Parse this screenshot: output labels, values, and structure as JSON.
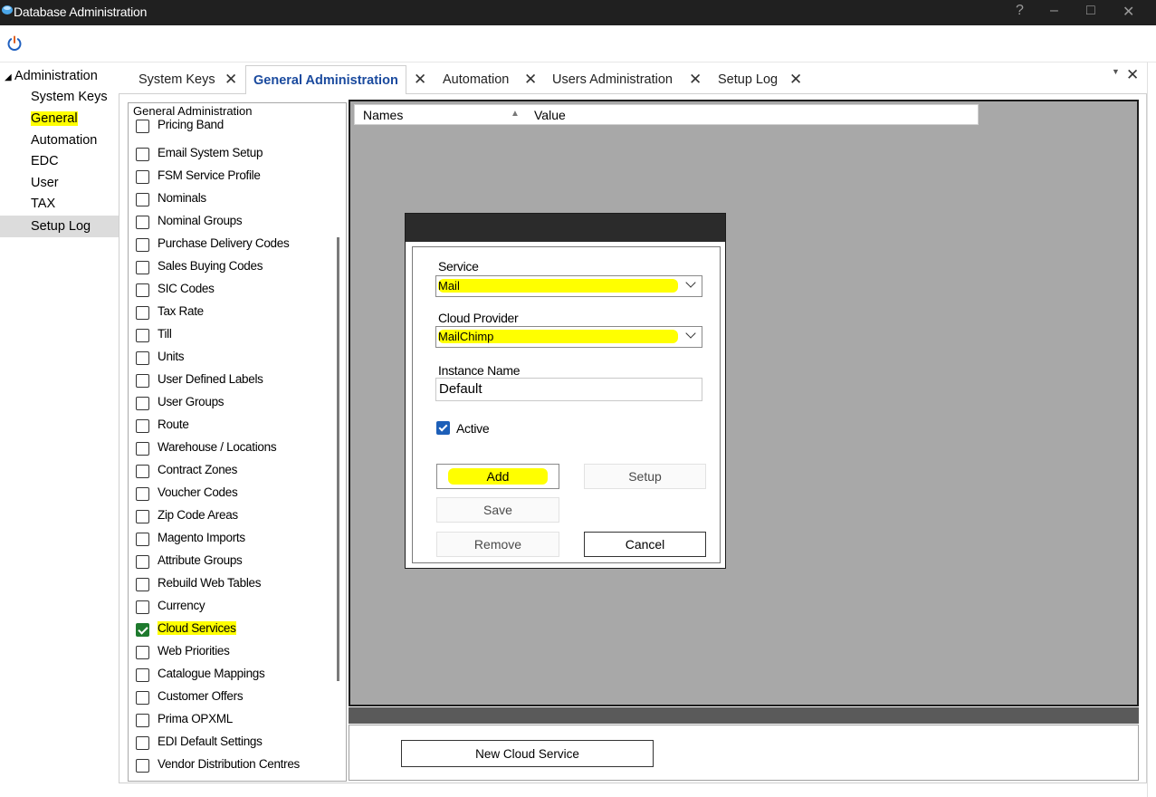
{
  "window": {
    "title": "Database Administration",
    "controls": [
      "?",
      "–",
      "□",
      "✕"
    ]
  },
  "toolbar": {
    "power_icon": "power-icon"
  },
  "tree": {
    "root": "Administration",
    "items": [
      {
        "label": "System Keys"
      },
      {
        "label": "General"
      },
      {
        "label": "Automation"
      },
      {
        "label": "EDC"
      },
      {
        "label": "User"
      },
      {
        "label": "TAX"
      },
      {
        "label": "Setup Log"
      }
    ]
  },
  "tabs": [
    {
      "label": "System Keys"
    },
    {
      "label": "General Administration"
    },
    {
      "label": "Automation"
    },
    {
      "label": "Users Administration"
    },
    {
      "label": "Setup Log"
    }
  ],
  "checklist": {
    "header": "General Administration",
    "items": [
      {
        "label": "Pricing Band",
        "checked": false
      },
      {
        "label": "Email System Setup",
        "checked": false
      },
      {
        "label": "FSM Service Profile",
        "checked": false
      },
      {
        "label": "Nominals",
        "checked": false
      },
      {
        "label": "Nominal Groups",
        "checked": false
      },
      {
        "label": "Purchase Delivery Codes",
        "checked": false
      },
      {
        "label": "Sales Buying Codes",
        "checked": false
      },
      {
        "label": "SIC Codes",
        "checked": false
      },
      {
        "label": "Tax Rate",
        "checked": false
      },
      {
        "label": "Till",
        "checked": false
      },
      {
        "label": "Units",
        "checked": false
      },
      {
        "label": "User Defined Labels",
        "checked": false
      },
      {
        "label": "User Groups",
        "checked": false
      },
      {
        "label": "Route",
        "checked": false
      },
      {
        "label": "Warehouse / Locations",
        "checked": false
      },
      {
        "label": "Contract Zones",
        "checked": false
      },
      {
        "label": "Voucher Codes",
        "checked": false
      },
      {
        "label": "Zip Code Areas",
        "checked": false
      },
      {
        "label": "Magento Imports",
        "checked": false
      },
      {
        "label": "Attribute Groups",
        "checked": false
      },
      {
        "label": "Rebuild Web Tables",
        "checked": false
      },
      {
        "label": "Currency",
        "checked": false
      },
      {
        "label": "Cloud Services",
        "checked": true
      },
      {
        "label": "Web Priorities",
        "checked": false
      },
      {
        "label": "Catalogue Mappings",
        "checked": false
      },
      {
        "label": "Customer Offers",
        "checked": false
      },
      {
        "label": "Prima OPXML",
        "checked": false
      },
      {
        "label": "EDI Default Settings",
        "checked": false
      },
      {
        "label": "Vendor Distribution Centres",
        "checked": false
      }
    ]
  },
  "grid": {
    "col_names": "Names",
    "col_value": "Value"
  },
  "dialog": {
    "service_label": "Service",
    "service_value": "Mail",
    "provider_label": "Cloud Provider",
    "provider_value": "MailChimp",
    "instance_label": "Instance Name",
    "instance_value": "Default",
    "active_label": "Active",
    "active_checked": true,
    "add_label": "Add",
    "setup_label": "Setup",
    "save_label": "Save",
    "remove_label": "Remove",
    "cancel_label": "Cancel"
  },
  "bottom": {
    "new_cloud_service_label": "New Cloud Service"
  },
  "colors": {
    "highlight": "#ffff00",
    "titlebar": "#202020",
    "active_tab_text": "#1a4a9e",
    "panel_gray": "#a8a8a8",
    "active_check": "#1d5fb8",
    "list_check": "#1e7a2e"
  }
}
